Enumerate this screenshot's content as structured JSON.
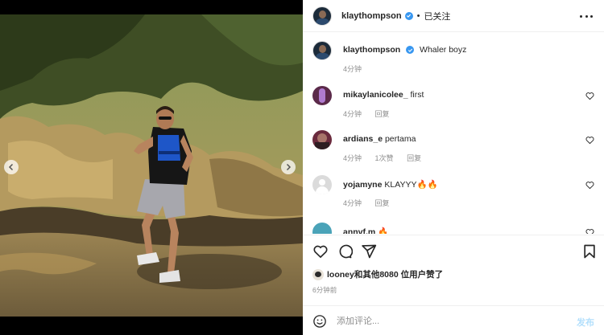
{
  "post": {
    "author": "klaythompson",
    "follow_state": "已关注",
    "separator": "•",
    "caption": "Whaler boyz",
    "caption_time": "4分钟"
  },
  "comments": [
    {
      "user": "mikaylanicolee_",
      "text": "first",
      "time": "4分钟",
      "reply": "回复",
      "likes": "",
      "avatar_color": "#5b2a4a"
    },
    {
      "user": "ardians_e",
      "text": "pertama",
      "time": "4分钟",
      "reply": "回复",
      "likes": "1次赞",
      "avatar_color": "#6a2a3d"
    },
    {
      "user": "yojamyne",
      "text": "KLAYYY🔥🔥",
      "time": "4分钟",
      "reply": "回复",
      "likes": "",
      "avatar_color": "#dbdbdb"
    },
    {
      "user": "annvf.m",
      "text": "🔥",
      "time": "",
      "reply": "",
      "likes": "",
      "avatar_color": "#4aa3b8"
    }
  ],
  "likes": {
    "text": "looney和其他8080 位用户赞了"
  },
  "post_time": "6分钟前",
  "comment_box": {
    "placeholder": "添加评论...",
    "post_label": "发布"
  },
  "colors": {
    "verified": "#3897f0",
    "muted": "#8e8e8e",
    "post_disabled": "#b2dffc"
  },
  "icons": [
    "verified-icon",
    "more-options-icon",
    "heart-icon",
    "comment-icon",
    "share-icon",
    "save-icon",
    "emoji-icon",
    "chevron-left-icon",
    "chevron-right-icon"
  ]
}
